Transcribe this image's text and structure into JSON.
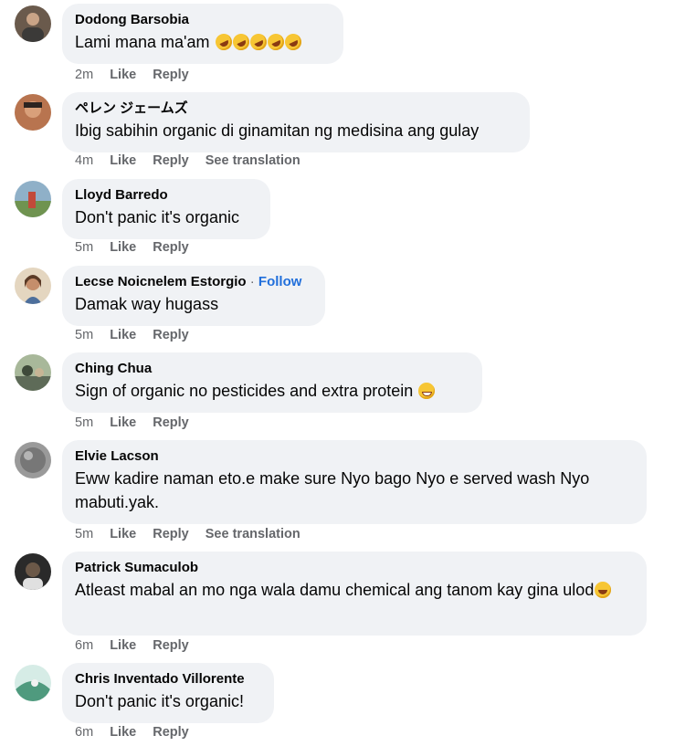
{
  "comments": [
    {
      "author": "Dodong Barsobia",
      "text": "Lami mana ma'am",
      "emoji_count": 5,
      "emoji": "rolling-on-floor-laughing-icon",
      "time": "2m",
      "like": "Like",
      "reply": "Reply",
      "avatar_color": "#6a5a4c"
    },
    {
      "author": "ペレン ジェームズ",
      "text": "Ibig sabihin organic di ginamitan ng medisina ang gulay",
      "time": "4m",
      "like": "Like",
      "reply": "Reply",
      "translation": "See translation",
      "avatar_color": "#b8744f"
    },
    {
      "author": "Lloyd Barredo",
      "text": "Don't panic it's organic",
      "time": "5m",
      "like": "Like",
      "reply": "Reply",
      "avatar_color": "#7a9a5a"
    },
    {
      "author": "Lecse Noicnelem Estorgio",
      "follow": "Follow",
      "dot": "·",
      "text": "Damak way hugass",
      "time": "5m",
      "like": "Like",
      "reply": "Reply",
      "avatar_color": "#c9b08a"
    },
    {
      "author": "Ching Chua",
      "text": "Sign of organic no pesticides and extra protein",
      "emoji": "grinning-face-icon",
      "time": "5m",
      "like": "Like",
      "reply": "Reply",
      "avatar_color": "#6f7f6a"
    },
    {
      "author": "Elvie Lacson",
      "text": "Eww kadire naman eto.e make sure Nyo bago Nyo e served wash Nyo mabuti.yak.",
      "time": "5m",
      "like": "Like",
      "reply": "Reply",
      "translation": "See translation",
      "avatar_color": "#8c8c8c"
    },
    {
      "author": "Patrick Sumaculob",
      "text": "Atleast mabal an mo nga wala damu chemical ang tanom kay gina ulod",
      "emoji": "face-with-tongue-icon",
      "time": "6m",
      "like": "Like",
      "reply": "Reply",
      "avatar_color": "#3a3a3a"
    },
    {
      "author": "Chris Inventado Villorente",
      "text": "Don't panic it's organic!",
      "time": "6m",
      "like": "Like",
      "reply": "Reply",
      "avatar_color": "#4f9a7e"
    }
  ]
}
